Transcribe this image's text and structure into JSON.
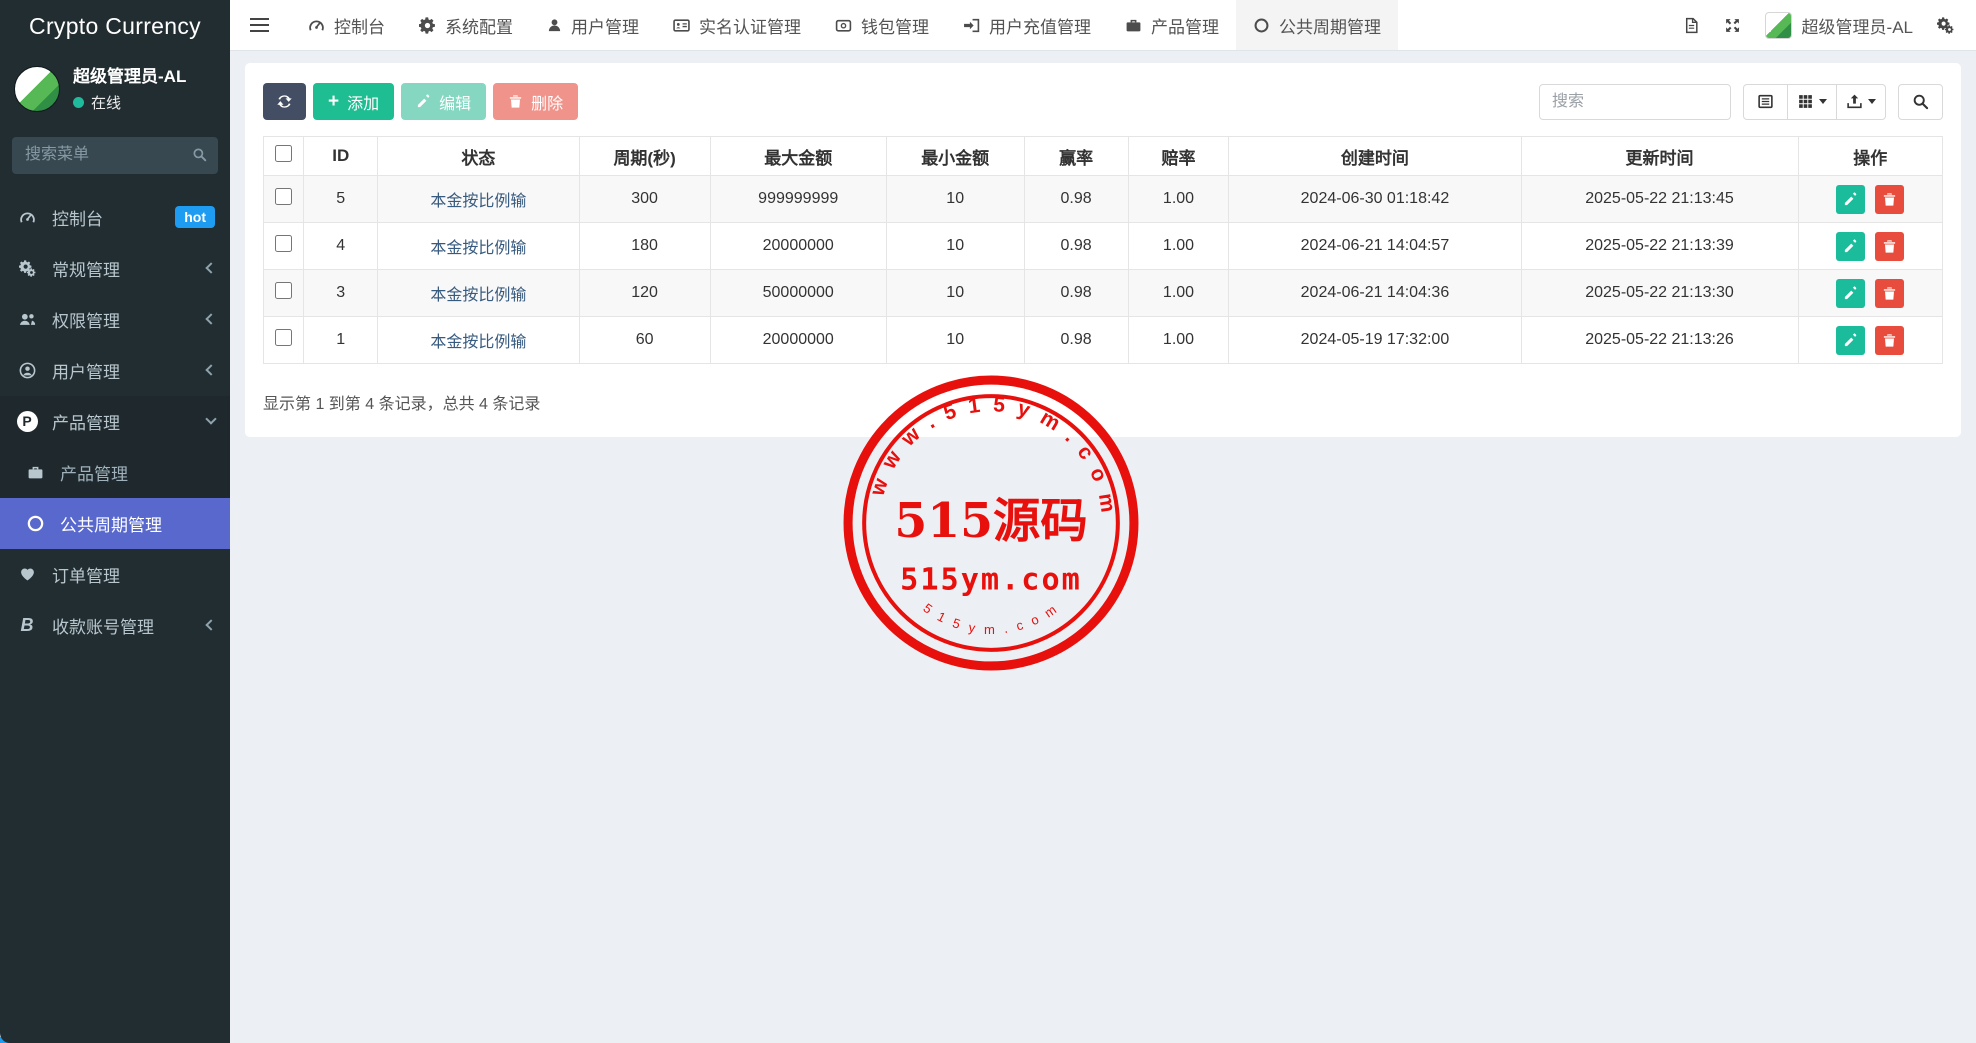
{
  "app": {
    "title": "Crypto Currency"
  },
  "sidebar": {
    "user": {
      "name": "超级管理员-AL",
      "status": "在线"
    },
    "search_placeholder": "搜索菜单",
    "items": [
      {
        "icon": "dashboard-icon",
        "label": "控制台",
        "badge": "hot"
      },
      {
        "icon": "cogs-icon",
        "label": "常规管理"
      },
      {
        "icon": "users-icon",
        "label": "权限管理"
      },
      {
        "icon": "user-circle-icon",
        "label": "用户管理"
      },
      {
        "icon": "product-p-icon",
        "label": "产品管理"
      },
      {
        "icon": "briefcase-icon",
        "label": "产品管理"
      },
      {
        "icon": "circle-icon",
        "label": "公共周期管理"
      },
      {
        "icon": "heartbeat-icon",
        "label": "订单管理"
      },
      {
        "icon": "bitcoin-icon",
        "label": "收款账号管理"
      }
    ]
  },
  "navbar": {
    "tabs": [
      {
        "icon": "dashboard-icon",
        "label": "控制台"
      },
      {
        "icon": "gear-icon",
        "label": "系统配置"
      },
      {
        "icon": "user-icon",
        "label": "用户管理"
      },
      {
        "icon": "id-card-icon",
        "label": "实名认证管理"
      },
      {
        "icon": "wallet-icon",
        "label": "钱包管理"
      },
      {
        "icon": "sign-in-icon",
        "label": "用户充值管理"
      },
      {
        "icon": "briefcase-icon",
        "label": "产品管理"
      },
      {
        "icon": "circle-icon",
        "label": "公共周期管理"
      }
    ],
    "user_name": "超级管理员-AL"
  },
  "toolbar": {
    "add_label": "添加",
    "edit_label": "编辑",
    "delete_label": "删除",
    "search_placeholder": "搜索"
  },
  "table": {
    "columns": [
      "ID",
      "状态",
      "周期(秒)",
      "最大金额",
      "最小金额",
      "赢率",
      "赔率",
      "创建时间",
      "更新时间",
      "操作"
    ],
    "rows": [
      {
        "id": "5",
        "status": "本金按比例输",
        "period": "300",
        "max": "999999999",
        "min": "10",
        "win": "0.98",
        "odds": "1.00",
        "created": "2024-06-30 01:18:42",
        "updated": "2025-05-22 21:13:45"
      },
      {
        "id": "4",
        "status": "本金按比例输",
        "period": "180",
        "max": "20000000",
        "min": "10",
        "win": "0.98",
        "odds": "1.00",
        "created": "2024-06-21 14:04:57",
        "updated": "2025-05-22 21:13:39"
      },
      {
        "id": "3",
        "status": "本金按比例输",
        "period": "120",
        "max": "50000000",
        "min": "10",
        "win": "0.98",
        "odds": "1.00",
        "created": "2024-06-21 14:04:36",
        "updated": "2025-05-22 21:13:30"
      },
      {
        "id": "1",
        "status": "本金按比例输",
        "period": "60",
        "max": "20000000",
        "min": "10",
        "win": "0.98",
        "odds": "1.00",
        "created": "2024-05-19 17:32:00",
        "updated": "2025-05-22 21:13:26"
      }
    ],
    "summary": "显示第 1 到第 4 条记录，总共 4 条记录"
  },
  "watermark": {
    "arc_top": "w w w . 5 1 5 y m . c o m",
    "center": "515源码",
    "domain": "515ym.com",
    "arc_bottom": "5 1 5 y m . c o m"
  },
  "colors": {
    "sidebar_bg": "#222d32",
    "active_menu": "#5968cc",
    "hot_badge": "#1e9cf2",
    "online_dot": "#1ebc9c",
    "refresh_button": "#434d63",
    "add_button": "#1fbd92",
    "row_edit_button": "#1abc9c",
    "row_delete_button": "#e74c3c",
    "stamp_red": "#e8100c"
  }
}
